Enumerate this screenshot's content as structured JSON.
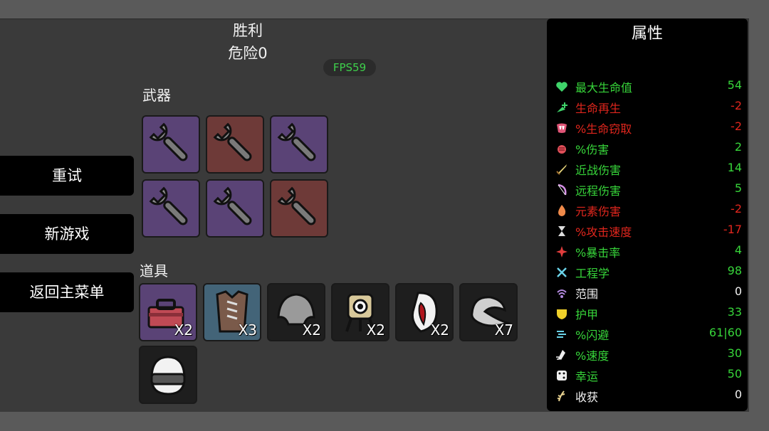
{
  "header": {
    "title": "胜利",
    "danger": "危险0",
    "fps": "FPS59"
  },
  "menu": {
    "retry": "重试",
    "new_game": "新游戏",
    "main_menu": "返回主菜单"
  },
  "weapons": {
    "label": "武器",
    "slots": [
      {
        "icon": "wrench-icon",
        "tier_color": "#5a4376"
      },
      {
        "icon": "wrench-icon",
        "tier_color": "#6e3a38"
      },
      {
        "icon": "wrench-icon",
        "tier_color": "#5a4376"
      },
      {
        "icon": "wrench-icon",
        "tier_color": "#5a4376"
      },
      {
        "icon": "wrench-icon",
        "tier_color": "#5a4376"
      },
      {
        "icon": "wrench-icon",
        "tier_color": "#6e3a38"
      }
    ]
  },
  "items": {
    "label": "道具",
    "slots": [
      {
        "icon": "toolbox-icon",
        "count": "X2"
      },
      {
        "icon": "leather-armor-icon",
        "count": "X3"
      },
      {
        "icon": "helmet-icon",
        "count": "X2"
      },
      {
        "icon": "turret-icon",
        "count": "X2"
      },
      {
        "icon": "fang-icon",
        "count": "X2"
      },
      {
        "icon": "scarf-icon",
        "count": "X7"
      },
      {
        "icon": "visor-helmet-icon",
        "count": ""
      }
    ]
  },
  "stats": {
    "title": "属性",
    "rows": [
      {
        "icon": "heart-icon",
        "name": "最大生命值",
        "value": "54",
        "color": "green"
      },
      {
        "icon": "regen-icon",
        "name": "生命再生",
        "value": "-2",
        "color": "neg"
      },
      {
        "icon": "lifesteal-icon",
        "name": "%生命窃取",
        "value": "-2",
        "color": "neg"
      },
      {
        "icon": "damage-icon",
        "name": "%伤害",
        "value": "2",
        "color": "green"
      },
      {
        "icon": "melee-icon",
        "name": "近战伤害",
        "value": "14",
        "color": "green"
      },
      {
        "icon": "ranged-icon",
        "name": "远程伤害",
        "value": "5",
        "color": "green"
      },
      {
        "icon": "elemental-icon",
        "name": "元素伤害",
        "value": "-2",
        "color": "neg"
      },
      {
        "icon": "hourglass-icon",
        "name": "%攻击速度",
        "value": "-17",
        "color": "neg"
      },
      {
        "icon": "crit-icon",
        "name": "%暴击率",
        "value": "4",
        "color": "green"
      },
      {
        "icon": "engineering-icon",
        "name": "工程学",
        "value": "98",
        "color": "green"
      },
      {
        "icon": "range-icon",
        "name": "范围",
        "value": "0",
        "color": "white"
      },
      {
        "icon": "shield-icon",
        "name": "护甲",
        "value": "33",
        "color": "green"
      },
      {
        "icon": "dodge-icon",
        "name": "%闪避",
        "value": "61|60",
        "color": "green"
      },
      {
        "icon": "speed-icon",
        "name": "%速度",
        "value": "30",
        "color": "green"
      },
      {
        "icon": "dice-icon",
        "name": "幸运",
        "value": "50",
        "color": "green"
      },
      {
        "icon": "harvest-icon",
        "name": "收获",
        "value": "0",
        "color": "white"
      }
    ]
  }
}
